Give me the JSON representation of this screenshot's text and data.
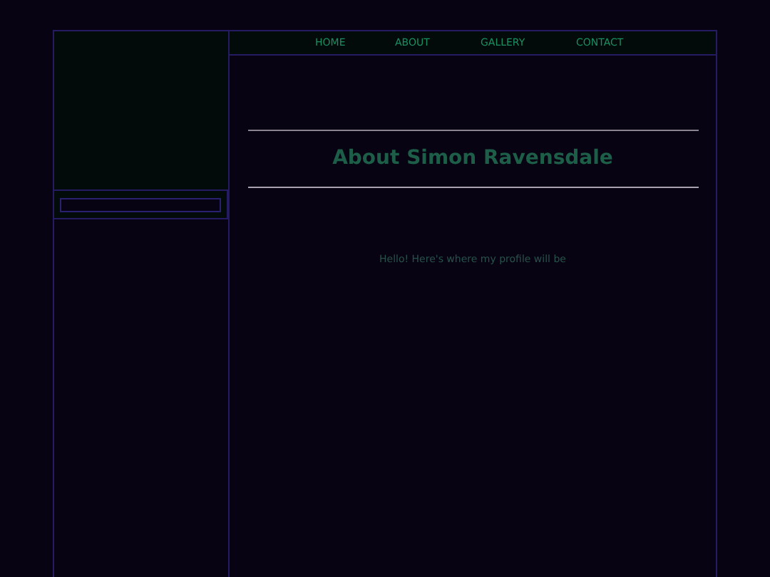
{
  "nav": {
    "items": [
      {
        "label": "HOME"
      },
      {
        "label": "ABOUT"
      },
      {
        "label": "GALLERY"
      },
      {
        "label": "CONTACT"
      }
    ]
  },
  "page": {
    "title": "About Simon Ravensdale",
    "body": "Hello! Here's where my profile will be"
  }
}
